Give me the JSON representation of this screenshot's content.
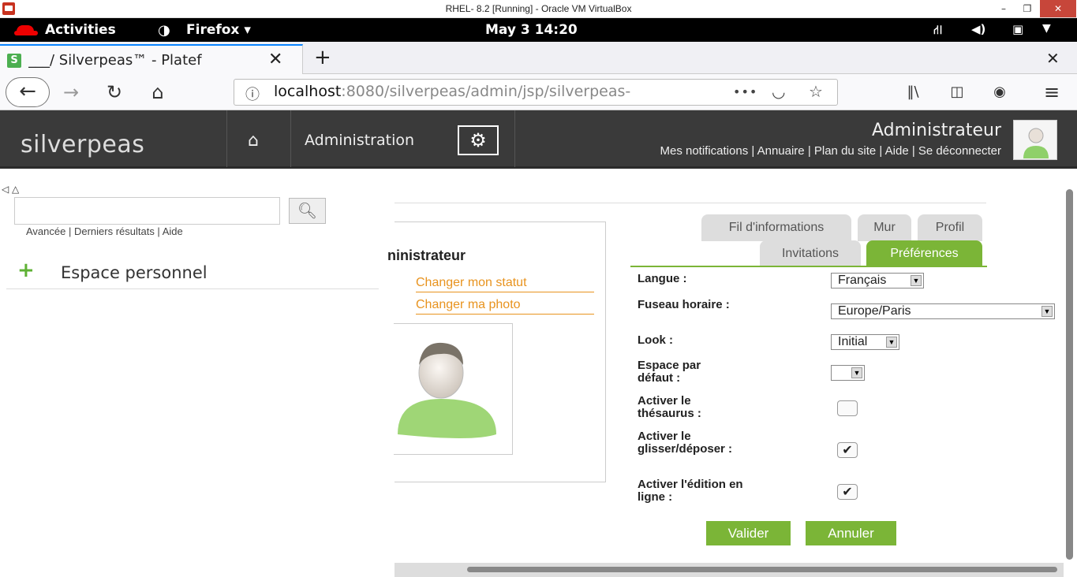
{
  "vbox": {
    "title": "RHEL- 8.2 [Running] - Oracle VM VirtualBox",
    "min": "–",
    "max": "❐",
    "close": "✕"
  },
  "gnome": {
    "activities": "Activities",
    "app": "Firefox ▾",
    "clock": "May 3  14:20"
  },
  "browser": {
    "tab_title": "___/ Silverpeas™ - Platef",
    "tab_favicon": "S",
    "tab_close": "✕",
    "new_tab": "+",
    "close_window": "✕",
    "url_host": "localhost",
    "url_rest": ":8080/silverpeas/admin/jsp/silverpeas-",
    "more": "•••"
  },
  "header": {
    "logo": "silverpeas",
    "admin_label": "Administration",
    "user_name": "Administrateur",
    "links": "Mes notifications | Annuaire | Plan du site | Aide | Se déconnecter"
  },
  "left": {
    "search_placeholder": "",
    "search_links": "Avancée | Derniers résultats | Aide",
    "space_label": "Espace personnel"
  },
  "profile": {
    "name_fragment": "ninistrateur",
    "change_status": "Changer mon statut",
    "change_photo": "Changer ma photo"
  },
  "tabs": {
    "row1": [
      "Fil d'informations",
      "Mur",
      "Profil"
    ],
    "row2": [
      "Invitations",
      "Préférences"
    ]
  },
  "form": {
    "langue_label": "Langue :",
    "langue_value": "Français",
    "fuseau_label": "Fuseau horaire :",
    "fuseau_value": "Europe/Paris",
    "look_label": "Look :",
    "look_value": "Initial",
    "espace_label": "Espace par défaut :",
    "espace_value": "",
    "thesaurus_label": "Activer le thésaurus :",
    "thesaurus_checked": false,
    "dragdrop_label": "Activer le glisser/déposer :",
    "dragdrop_checked": true,
    "edition_label": "Activer l'édition en ligne :",
    "edition_checked": true,
    "check_mark": "✔",
    "submit": "Valider",
    "cancel": "Annuler"
  },
  "colors": {
    "accent": "#7bb537",
    "link": "#e8931e",
    "header_bg": "#3a3a3a"
  }
}
